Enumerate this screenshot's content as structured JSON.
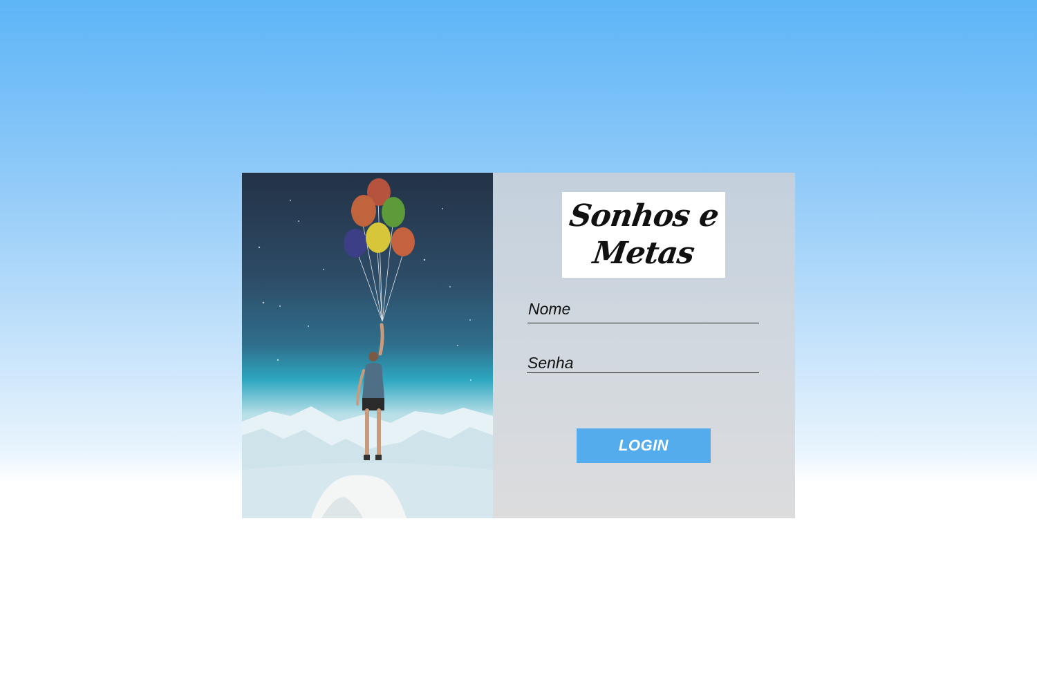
{
  "logo": {
    "line1": "Sonhos e",
    "line2": "Metas"
  },
  "form": {
    "name_placeholder": "Nome",
    "password_placeholder": "Senha",
    "login_label": "LOGIN"
  },
  "colors": {
    "sky_top": "#5db5f7",
    "button": "#55acec",
    "panel": "#d1d8df"
  }
}
